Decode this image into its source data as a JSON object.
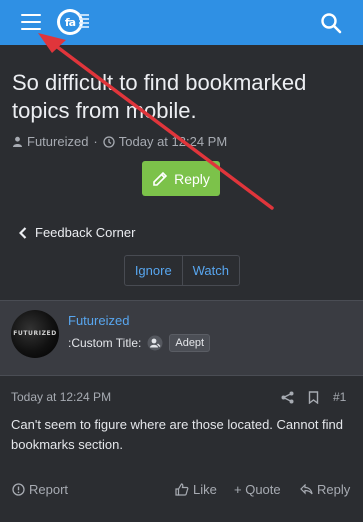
{
  "header": {
    "logo_text": "fa"
  },
  "thread": {
    "title": "So difficult to find bookmarked topics from mobile.",
    "author": "Futureized",
    "separator": "·",
    "time": "Today at 12:24 PM",
    "reply_label": "Reply",
    "back_label": "Feedback Corner",
    "ignore_label": "Ignore",
    "watch_label": "Watch"
  },
  "post": {
    "avatar_text": "FUTURIZED",
    "username": "Futureized",
    "custom_title_label": ":Custom Title:",
    "badge": "Adept",
    "date": "Today at 12:24 PM",
    "number": "#1",
    "text": "Can't seem to figure where are those located. Cannot find bookmarks section.",
    "report_label": "Report",
    "like_label": "Like",
    "quote_label": "+ Quote",
    "reply_label": "Reply"
  },
  "colors": {
    "topbar": "#2f90e4",
    "background": "#2b2d31",
    "user_block": "#3a3c42",
    "reply_button": "#7cc24a",
    "link": "#58a6ef",
    "annotation_arrow": "#e0353b"
  },
  "icons": [
    "hamburger-icon",
    "search-icon",
    "user-icon",
    "clock-icon",
    "reply-icon",
    "chevron-left-icon",
    "rank-icon",
    "share-icon",
    "bookmark-icon",
    "report-icon",
    "like-icon",
    "reply-small-icon"
  ]
}
